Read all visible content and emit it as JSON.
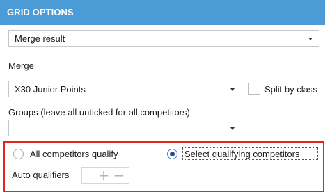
{
  "header": {
    "title": "GRID OPTIONS"
  },
  "result_type": {
    "value": "Merge result"
  },
  "merge": {
    "label": "Merge",
    "value": "X30 Junior Points",
    "split_label": "Split by class"
  },
  "groups": {
    "label": "Groups (leave all unticked for all competitors)",
    "value": ""
  },
  "qualify": {
    "option_all": "All competitors qualify",
    "option_select": "Select qualifying competitors",
    "selected": "Select qualifying competitors"
  },
  "auto_qualifiers": {
    "label": "Auto qualifiers",
    "add_symbol": "+",
    "remove_symbol": "−"
  },
  "colors": {
    "header_bg": "#4b9bd6",
    "highlight_border": "#e2261d"
  }
}
